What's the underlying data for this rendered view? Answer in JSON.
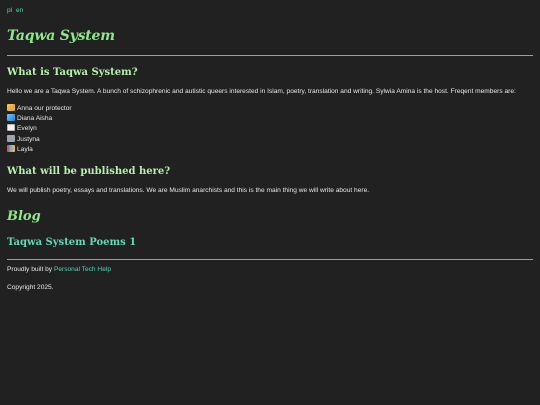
{
  "header": {
    "languages": [
      "pl",
      "en"
    ],
    "site_title": "Taqwa System"
  },
  "about": {
    "heading": "What is Taqwa System?",
    "intro": "Hello we are a Taqwa System. A bunch of schizophrenic and autistic queers interested in Islam, poetry, translation and writing. Sylwia Amina is the host. Freqent members are:",
    "members": [
      {
        "icon": "sun-flower-icon",
        "name": "Anna our protector"
      },
      {
        "icon": "wave-icon",
        "name": "Diana Aisha"
      },
      {
        "icon": "page-icon",
        "name": "Evelyn"
      },
      {
        "icon": "robot-icon",
        "name": "Justyna"
      },
      {
        "icon": "books-icon",
        "name": "Layla"
      }
    ]
  },
  "publish": {
    "heading": "What will be published here?",
    "text": "We will publish poetry, essays and translations. We are Muslim anarchists and this is the main thing we will write about here."
  },
  "blog": {
    "heading": "Blog",
    "posts": [
      "Taqwa System Poems 1"
    ]
  },
  "footer": {
    "built_prefix": "Proudly built by",
    "built_link": "Personal Tech Help",
    "copyright": "Copyright 2025."
  },
  "colors": {
    "background": "#212121",
    "title_green": "#8ee88a",
    "link_teal": "#4fd6b5",
    "rule_green": "#6fbf6a"
  }
}
